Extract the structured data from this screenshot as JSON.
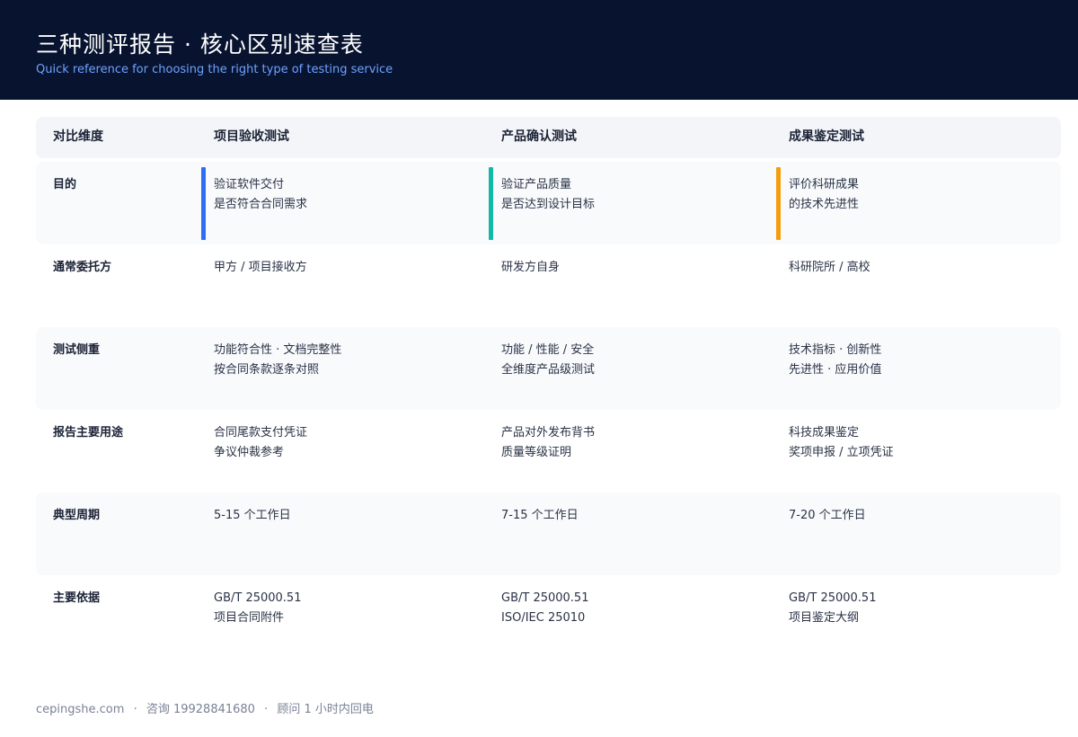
{
  "header": {
    "title": "三种测评报告 · 核心区别速查表",
    "subtitle": "Quick reference for choosing the right type of testing service"
  },
  "table": {
    "columns": [
      "对比维度",
      "项目验收测试",
      "产品确认测试",
      "成果鉴定测试"
    ],
    "accent_colors": [
      "#2f6df6",
      "#14b8a6",
      "#f59e0b"
    ],
    "rows": [
      {
        "label": "目的",
        "cells": [
          [
            "验证软件交付",
            "是否符合合同需求"
          ],
          [
            "验证产品质量",
            "是否达到设计目标"
          ],
          [
            "评价科研成果",
            "的技术先进性"
          ]
        ]
      },
      {
        "label": "通常委托方",
        "cells": [
          [
            "甲方 / 项目接收方"
          ],
          [
            "研发方自身"
          ],
          [
            "科研院所 / 高校"
          ]
        ]
      },
      {
        "label": "测试侧重",
        "cells": [
          [
            "功能符合性 · 文档完整性",
            "按合同条款逐条对照"
          ],
          [
            "功能 / 性能 / 安全",
            "全维度产品级测试"
          ],
          [
            "技术指标 · 创新性",
            "先进性 · 应用价值"
          ]
        ]
      },
      {
        "label": "报告主要用途",
        "cells": [
          [
            "合同尾款支付凭证",
            "争议仲裁参考"
          ],
          [
            "产品对外发布背书",
            "质量等级证明"
          ],
          [
            "科技成果鉴定",
            "奖项申报 / 立项凭证"
          ]
        ]
      },
      {
        "label": "典型周期",
        "cells": [
          [
            "5-15 个工作日"
          ],
          [
            "7-15 个工作日"
          ],
          [
            "7-20 个工作日"
          ]
        ]
      },
      {
        "label": "主要依据",
        "cells": [
          [
            "GB/T 25000.51",
            "项目合同附件"
          ],
          [
            "GB/T 25000.51",
            "ISO/IEC 25010"
          ],
          [
            "GB/T 25000.51",
            "项目鉴定大纲"
          ]
        ]
      }
    ]
  },
  "footer": {
    "site": "cepingshe.com",
    "sep": "·",
    "contact": "咨询 19928841680",
    "reply": "顾问 1 小时内回电"
  }
}
